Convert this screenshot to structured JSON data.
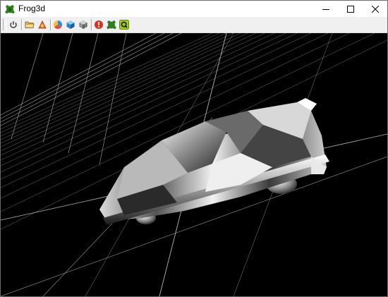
{
  "window": {
    "title": "Frog3d",
    "controls": [
      "minimize",
      "maximize",
      "close"
    ]
  },
  "toolbar": {
    "buttons": [
      {
        "name": "power-icon"
      },
      {
        "name": "open-folder-icon"
      },
      {
        "name": "import-model-icon"
      },
      {
        "name": "color-wheel-icon"
      },
      {
        "name": "cube-icon"
      },
      {
        "name": "wireframe-cube-icon"
      },
      {
        "name": "info-icon"
      },
      {
        "name": "frog-icon"
      },
      {
        "name": "q-icon"
      }
    ]
  },
  "viewport": {
    "background": "#000000",
    "grid_color": "#9a9a9a",
    "model": "car"
  }
}
